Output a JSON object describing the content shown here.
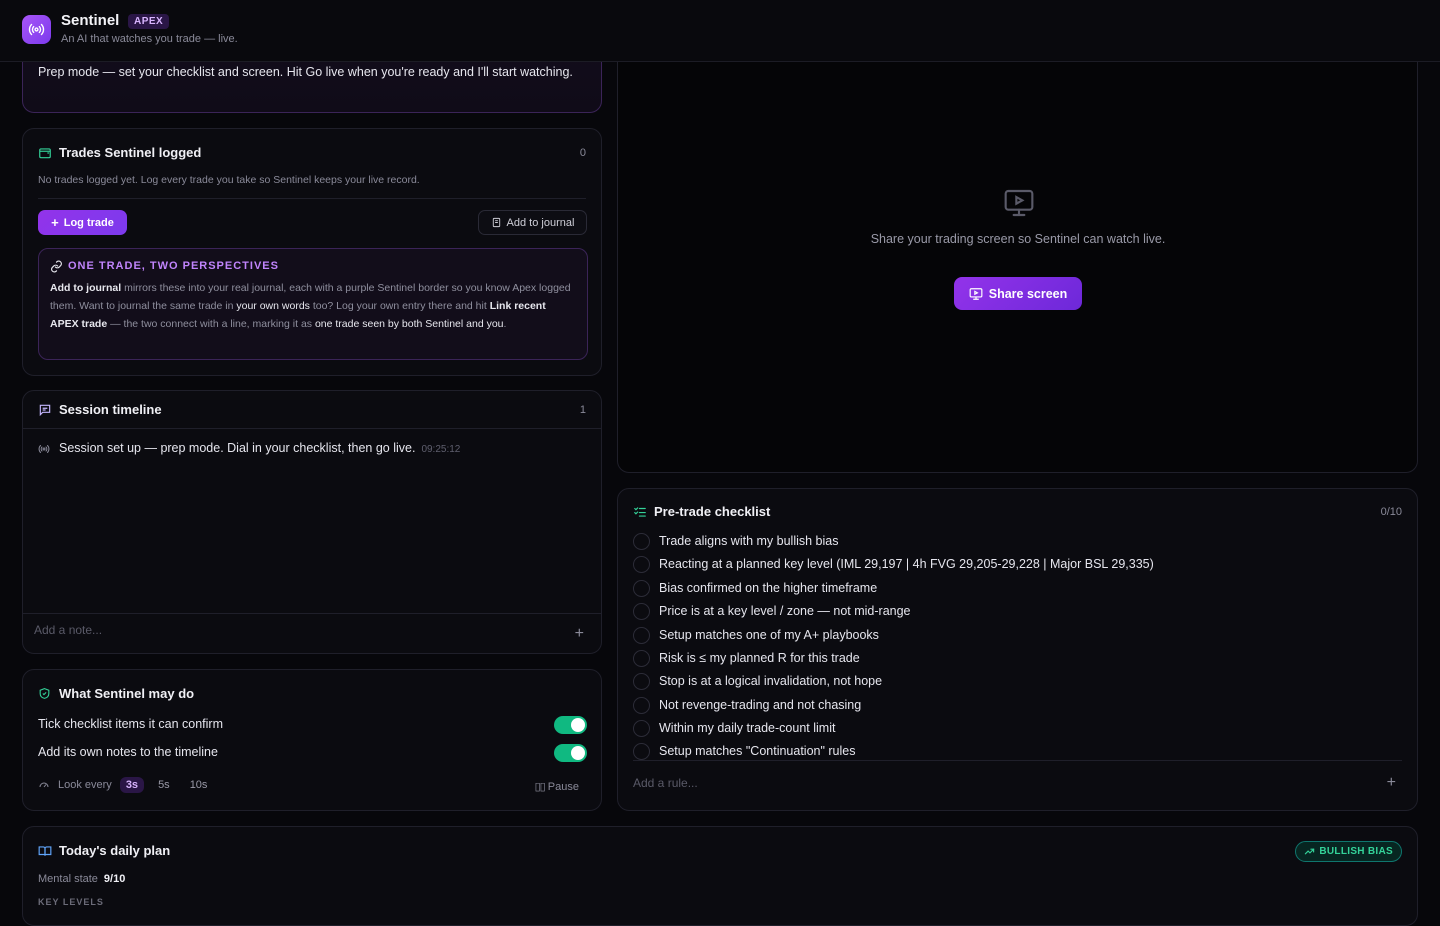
{
  "header": {
    "app_name": "Sentinel",
    "badge": "APEX",
    "tagline": "An AI that watches you trade — live."
  },
  "prep": {
    "text": "Prep mode — set your checklist and screen. Hit Go live when you're ready and I'll start watching."
  },
  "trades": {
    "title": "Trades Sentinel logged",
    "count": "0",
    "empty_text": "No trades logged yet. Log every trade you take so Sentinel keeps your live record.",
    "log_button": "Log trade",
    "journal_button": "Add to journal",
    "perspective": {
      "title": "ONE TRADE, TWO PERSPECTIVES",
      "b1": "Add to journal",
      "t1": " mirrors these into your real journal, each with a purple Sentinel border so you know Apex logged them. Want to journal the same trade in ",
      "h1": "your own words",
      "t2": " too? Log your own entry there and hit ",
      "b2": "Link recent APEX trade",
      "t3": " — the two connect with a line, marking it as ",
      "h2": "one trade seen by both Sentinel and you",
      "t4": "."
    }
  },
  "timeline": {
    "title": "Session timeline",
    "count": "1",
    "entry_text": "Session set up — prep mode. Dial in your checklist, then go live.",
    "entry_time": "09:25:12",
    "note_placeholder": "Add a note..."
  },
  "permissions": {
    "title": "What Sentinel may do",
    "items": [
      {
        "label": "Tick checklist items it can confirm",
        "enabled": true
      },
      {
        "label": "Add its own notes to the timeline",
        "enabled": true
      }
    ],
    "look_every_label": "Look every",
    "intervals": [
      "3s",
      "5s",
      "10s"
    ],
    "selected_interval": "3s",
    "pause_label": "Pause"
  },
  "screen": {
    "prompt": "Share your trading screen so Sentinel can watch live.",
    "share_button": "Share screen"
  },
  "checklist": {
    "title": "Pre-trade checklist",
    "count": "0/10",
    "items": [
      "Trade aligns with my bullish bias",
      "Reacting at a planned key level (IML 29,197 | 4h FVG 29,205-29,228 | Major BSL 29,335)",
      "Bias confirmed on the higher timeframe",
      "Price is at a key level / zone — not mid-range",
      "Setup matches one of my A+ playbooks",
      "Risk is ≤ my planned R for this trade",
      "Stop is at a logical invalidation, not hope",
      "Not revenge-trading and not chasing",
      "Within my daily trade-count limit",
      "Setup matches \"Continuation\" rules"
    ],
    "rule_placeholder": "Add a rule..."
  },
  "plan": {
    "title": "Today's daily plan",
    "bias_badge": "BULLISH BIAS",
    "mental_label": "Mental state",
    "mental_value": "9/10",
    "key_levels_label": "KEY LEVELS"
  },
  "colors": {
    "accent": "#9333ea",
    "success": "#10b981",
    "background": "#07070b"
  }
}
